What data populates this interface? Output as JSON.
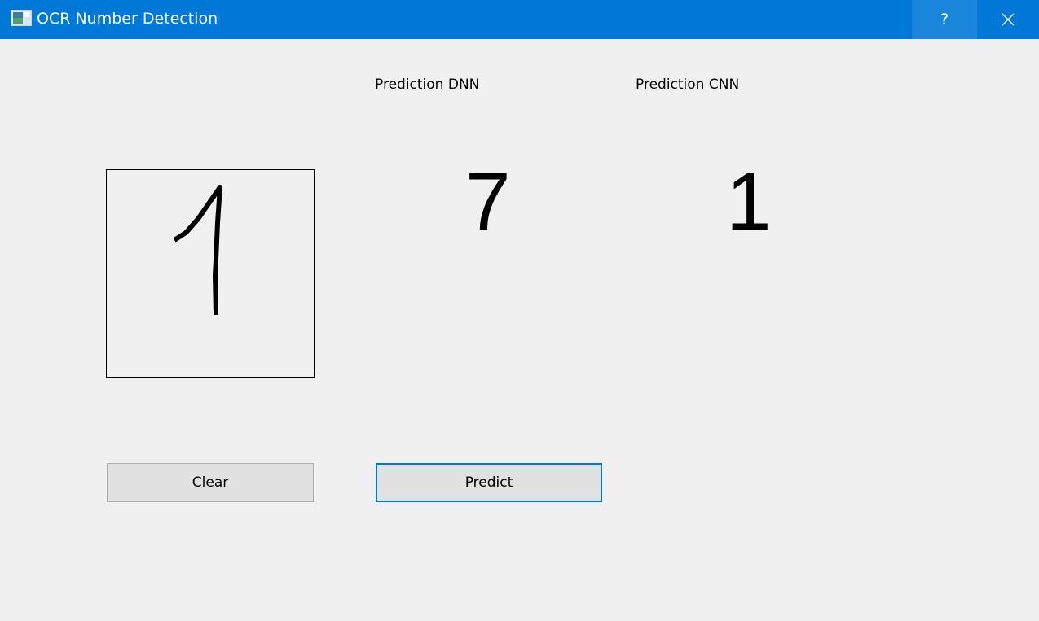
{
  "window": {
    "title": "OCR Number Detection",
    "help_label": "?"
  },
  "predictions": {
    "dnn_label": "Prediction DNN",
    "cnn_label": "Prediction CNN",
    "dnn_value": "7",
    "cnn_value": "1"
  },
  "buttons": {
    "clear_label": "Clear",
    "predict_label": "Predict"
  },
  "icons": {
    "app": "app-icon",
    "help": "help-icon",
    "close": "close-icon"
  },
  "colors": {
    "titlebar": "#0078d7",
    "background": "#f0f0f0",
    "focus_border": "#0078d7"
  }
}
